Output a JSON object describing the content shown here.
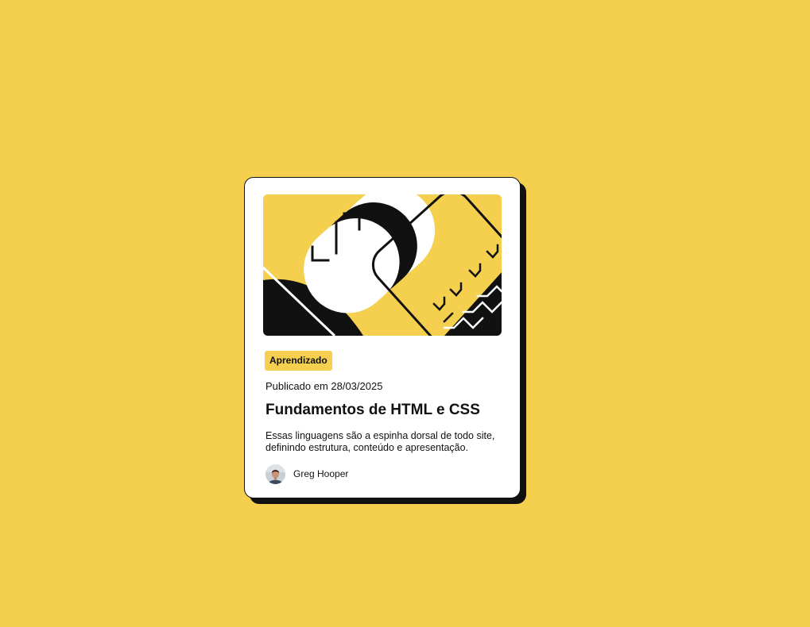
{
  "page": {
    "background_color": "#F4D04E"
  },
  "card": {
    "image_alt": "illustration-article",
    "tag": "Aprendizado",
    "published": "Publicado em 28/03/2025",
    "title": "Fundamentos de HTML e CSS",
    "description": "Essas linguagens são a espinha dorsal de todo site, definindo estrutura, conteúdo e apresentação.",
    "author": {
      "name": "Greg Hooper",
      "avatar_icon": "avatar-photo"
    },
    "colors": {
      "accent": "#F4D04E",
      "text": "#111111",
      "card_bg": "#FFFFFF"
    }
  }
}
